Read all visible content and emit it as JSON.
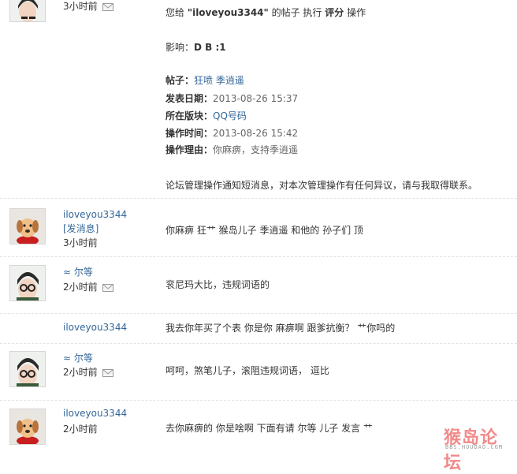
{
  "system_message": {
    "time": "3小时前",
    "line1": {
      "a": "您给 ",
      "target": "\"iloveyou3344\"",
      "b": " 的帖子 执行 ",
      "action": "评分",
      "c": " 操作"
    },
    "impact_label": "影响：",
    "impact_value": "D B :1",
    "fields": [
      {
        "label": "帖子：",
        "value": "狂喷 季逍遥",
        "link": true
      },
      {
        "label": "发表日期：",
        "value": "2013-08-26 15:37",
        "link": false
      },
      {
        "label": "所在版块：",
        "value": "QQ号码",
        "link": true
      },
      {
        "label": "操作时间：",
        "value": "2013-08-26 15:42",
        "link": false
      },
      {
        "label": "操作理由：",
        "value": "你麻痹，支持季逍遥",
        "link": false
      }
    ],
    "notice": "论坛管理操作通知短消息，对本次管理操作有任何异议，请与我取得联系。"
  },
  "messages": [
    {
      "user": "iloveyou3344",
      "send_label": "[发消息]",
      "time": "3小时前",
      "content": "你麻痹 狂艹 猴岛儿子 季逍遥 和他的 孙子们 顶"
    },
    {
      "user": "≈   尔等",
      "time": "2小时前",
      "content": "衮尼玛大比，违规词语的"
    },
    {
      "user": "iloveyou3344",
      "content": "我去你年买了个表 你是你 麻痹啊 跟爹抗衡？ 艹你吗的"
    },
    {
      "user": "≈   尔等",
      "time": "2小时前",
      "content": "呵呵，煞笔儿子，滚阻违规词语， 逗比"
    },
    {
      "user": "iloveyou3344",
      "time": "2小时前",
      "content": "去你麻痹的 你是啥啊 下面有请 尔等 儿子 发言 艹"
    }
  ],
  "watermark": {
    "main": "猴岛论坛",
    "sub": "BBS.HOUDAO.COM"
  },
  "colors": {
    "link": "#336699",
    "separator": "#e2e2e2",
    "watermark": "#f28a8a"
  },
  "icons": {
    "envelope": "envelope-icon",
    "avatar_boy": "avatar-boy-glasses",
    "avatar_dog": "avatar-dog"
  }
}
